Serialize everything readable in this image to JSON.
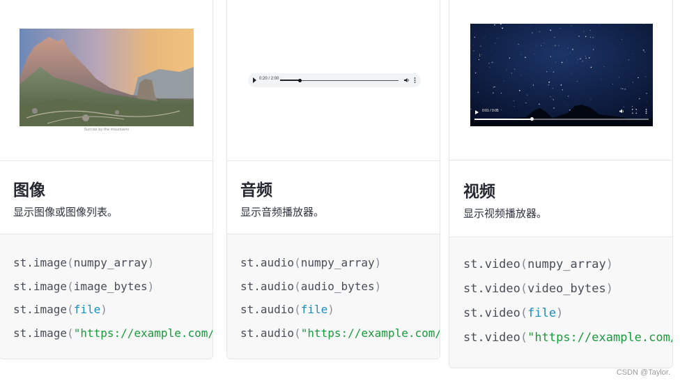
{
  "cards": [
    {
      "title": "图像",
      "description": "显示图像或图像列表。",
      "preview": {
        "caption": "Sunrise by the mountains"
      },
      "code": {
        "prefix": "st.image",
        "lines": [
          {
            "arg": "numpy_array",
            "kind": "plain"
          },
          {
            "arg": "image_bytes",
            "kind": "plain"
          },
          {
            "arg": "file",
            "kind": "keyword"
          },
          {
            "arg": "\"https://example.com/",
            "kind": "string"
          }
        ]
      }
    },
    {
      "title": "音频",
      "description": "显示音频播放器。",
      "preview": {
        "time": "0:20 / 2:00",
        "progress": 0.17
      },
      "code": {
        "prefix": "st.audio",
        "lines": [
          {
            "arg": "numpy_array",
            "kind": "plain"
          },
          {
            "arg": "audio_bytes",
            "kind": "plain"
          },
          {
            "arg": "file",
            "kind": "keyword"
          },
          {
            "arg": "\"https://example.com/",
            "kind": "string"
          }
        ]
      }
    },
    {
      "title": "视频",
      "description": "显示视频播放器。",
      "preview": {
        "time": "0:01 / 0:05",
        "progress": 0.33
      },
      "code": {
        "prefix": "st.video",
        "lines": [
          {
            "arg": "numpy_array",
            "kind": "plain"
          },
          {
            "arg": "video_bytes",
            "kind": "plain"
          },
          {
            "arg": "file",
            "kind": "keyword"
          },
          {
            "arg": "\"https://example.com/",
            "kind": "string"
          }
        ]
      }
    }
  ],
  "watermark": "CSDN @Taylor.",
  "colors": {
    "code_text": "#4a4c57",
    "code_keyword": "#1a8cbd",
    "code_string": "#1a9a3c",
    "card_border": "#e6e6e6",
    "code_background": "#f8f8f8"
  },
  "icons": [
    "play-icon",
    "volume-icon",
    "more-options-icon",
    "fullscreen-icon"
  ]
}
